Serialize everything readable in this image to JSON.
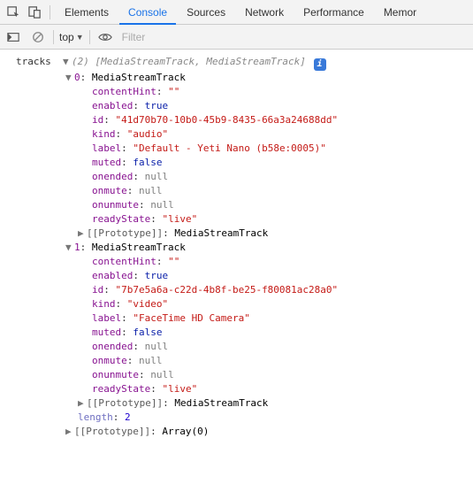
{
  "tabs": {
    "elements": "Elements",
    "console": "Console",
    "sources": "Sources",
    "network": "Network",
    "performance": "Performance",
    "memory": "Memor"
  },
  "subbar": {
    "scope": "top",
    "filter_placeholder": "Filter"
  },
  "console": {
    "tracks_var": "tracks",
    "array_len": "(2)",
    "array_preview": "[MediaStreamTrack, MediaStreamTrack]",
    "info_glyph": "i",
    "items": [
      {
        "index": "0",
        "type": "MediaStreamTrack",
        "props": {
          "contentHint": "\"\"",
          "enabled": "true",
          "id": "\"41d70b70-10b0-45b9-8435-66a3a24688dd\"",
          "kind": "\"audio\"",
          "label": "\"Default - Yeti Nano (b58e:0005)\"",
          "muted": "false",
          "onended": "null",
          "onmute": "null",
          "onunmute": "null",
          "readyState": "\"live\""
        },
        "prototype_label": "[[Prototype]]",
        "prototype_value": "MediaStreamTrack"
      },
      {
        "index": "1",
        "type": "MediaStreamTrack",
        "props": {
          "contentHint": "\"\"",
          "enabled": "true",
          "id": "\"7b7e5a6a-c22d-4b8f-be25-f80081ac28a0\"",
          "kind": "\"video\"",
          "label": "\"FaceTime HD Camera\"",
          "muted": "false",
          "onended": "null",
          "onmute": "null",
          "onunmute": "null",
          "readyState": "\"live\""
        },
        "prototype_label": "[[Prototype]]",
        "prototype_value": "MediaStreamTrack"
      }
    ],
    "length_label": "length",
    "length_value": "2",
    "proto_label": "[[Prototype]]",
    "proto_value": "Array(0)"
  }
}
